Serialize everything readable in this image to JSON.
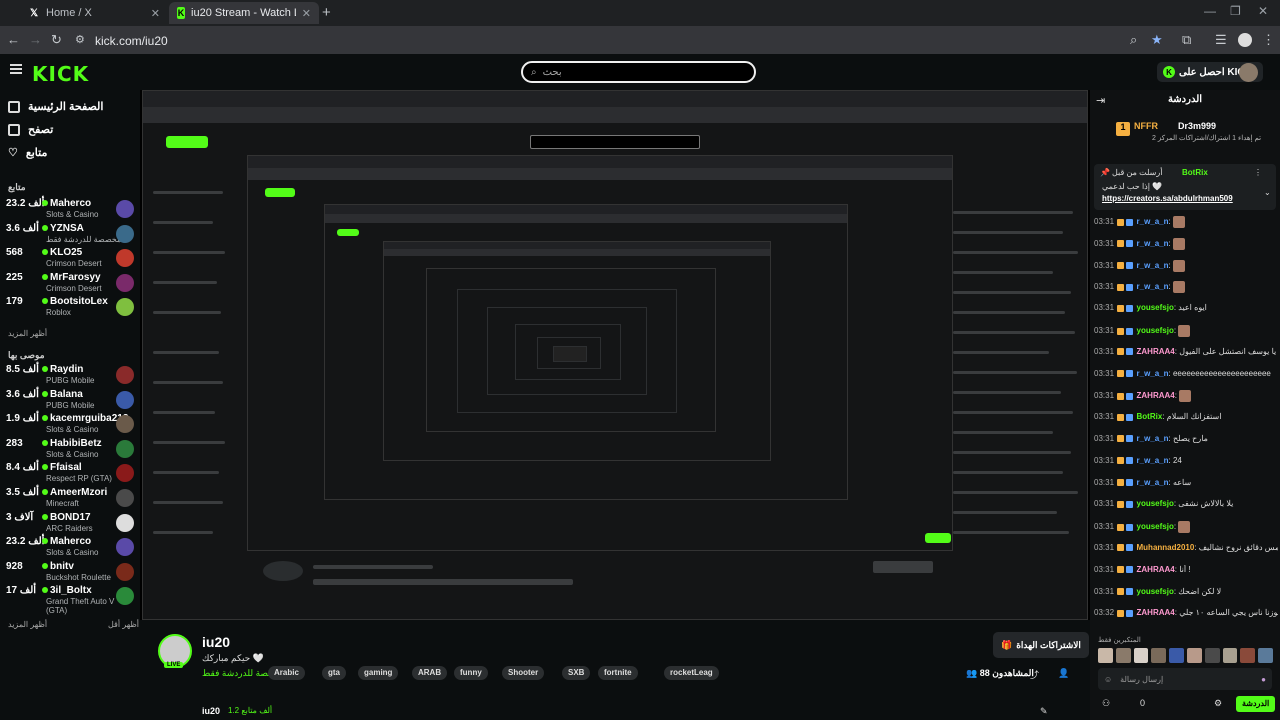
{
  "browser": {
    "tabs": [
      {
        "title": "Home / X",
        "icon": "x-logo-icon"
      },
      {
        "title": "iu20 Stream - Watch Live on Kic",
        "icon": "kick-logo-icon"
      }
    ],
    "new_tab": "+",
    "url": "kick.com/iu20"
  },
  "header": {
    "logo": "KICK",
    "search_placeholder": "بحث",
    "kicks_button": "احصل على KICKs"
  },
  "sidebar": {
    "nav": [
      {
        "label": "الصفحة الرئيسية",
        "icon": "home-icon"
      },
      {
        "label": "تصفح",
        "icon": "browse-icon"
      },
      {
        "label": "متابع",
        "icon": "heart-icon"
      }
    ],
    "following_title": "متابع",
    "following": [
      {
        "count": "23.2 ألف",
        "name": "Maherco",
        "category": "Slots & Casino",
        "color": "#5a4aa8"
      },
      {
        "count": "3.6 ألف",
        "name": "YZNSA",
        "category": "مخصصة للدردشة فقط",
        "color": "#3a6a8a"
      },
      {
        "count": "568",
        "name": "KLO25",
        "category": "Crimson Desert",
        "color": "#c0392b"
      },
      {
        "count": "225",
        "name": "MrFarosyy",
        "category": "Crimson Desert",
        "color": "#7a2a6a"
      },
      {
        "count": "179",
        "name": "BootsitoLex",
        "category": "Roblox",
        "color": "#7fbf3f"
      }
    ],
    "show_more_1": "أظهر المزيد",
    "recommended_title": "موصى بها",
    "recommended": [
      {
        "count": "8.5 ألف",
        "name": "Raydin",
        "category": "PUBG Mobile",
        "color": "#8a2a2a"
      },
      {
        "count": "3.6 ألف",
        "name": "Balana",
        "category": "PUBG Mobile",
        "color": "#3a5aa8"
      },
      {
        "count": "1.9 ألف",
        "name": "kacemrguiba213",
        "category": "Slots & Casino",
        "color": "#6a5a4a"
      },
      {
        "count": "283",
        "name": "HabibiBetz",
        "category": "Slots & Casino",
        "color": "#2a7a3a"
      },
      {
        "count": "8.4 ألف",
        "name": "Ffaisal",
        "category": "Respect RP (GTA)",
        "color": "#8a1a1a"
      },
      {
        "count": "3.5 ألف",
        "name": "AmeerMzori",
        "category": "Minecraft",
        "color": "#4a4a4a"
      },
      {
        "count": "3 آلاف",
        "name": "BOND17",
        "category": "ARC Raiders",
        "color": "#dddddd"
      },
      {
        "count": "23.2 ألف",
        "name": "Maherco",
        "category": "Slots & Casino",
        "color": "#5a4aa8"
      },
      {
        "count": "928",
        "name": "bnitv",
        "category": "Buckshot Roulette",
        "color": "#7a2a1a"
      },
      {
        "count": "17 ألف",
        "name": "3il_Boltx",
        "category": "Grand Theft Auto V (GTA)",
        "color": "#2a8a3a"
      }
    ],
    "show_more_2": "أظهر المزيد",
    "show_less": "أظهر أقل"
  },
  "stream": {
    "name": "iu20",
    "subtitle": "حيكم مباركك 🤍",
    "category": "مخصصة للدردشة فقط",
    "live": "LIVE",
    "tags": [
      "Arabic",
      "gta",
      "gaming",
      "ARAB",
      "funny",
      "Shooter",
      "SXB",
      "fortnite",
      "rocketLeag"
    ],
    "subs_button": "الاشتراكات الهداة",
    "viewers": "المشاهدون 88",
    "followers": "ألف متابع 1.2",
    "followers_name": "iu20"
  },
  "chat": {
    "title": "الدردشة",
    "top_user": "Dr3m999",
    "top_user_sub": "تم إهداء 1 اشتراك/اشتراكات المركز 2",
    "top_left": "NFFR",
    "pinned_by": "أرسلت من قبل",
    "pinned_user": "BotRix",
    "pinned_text": "إذا حب لدعمي 🤍",
    "pinned_link": "https://creators.sa/abdulrhman509",
    "messages": [
      {
        "time": "03:31",
        "user": "r_w_a_n",
        "text": "",
        "color": "#5aa0ff"
      },
      {
        "time": "03:31",
        "user": "r_w_a_n",
        "text": "",
        "color": "#5aa0ff"
      },
      {
        "time": "03:31",
        "user": "r_w_a_n",
        "text": "",
        "color": "#5aa0ff"
      },
      {
        "time": "03:31",
        "user": "r_w_a_n",
        "text": "",
        "color": "#5aa0ff"
      },
      {
        "time": "03:31",
        "user": "yousefsjo",
        "text": "ايوه اعيد",
        "color": "#53fc18"
      },
      {
        "time": "03:31",
        "user": "yousefsjo",
        "text": "",
        "color": "#53fc18"
      },
      {
        "time": "03:31",
        "user": "ZAHRAA4",
        "text": "يا يوسف انصتشل على الفيول",
        "color": "#ff9ad0"
      },
      {
        "time": "03:31",
        "user": "r_w_a_n",
        "text": "eeeeeeeeeeeeeeeeeeeeee",
        "color": "#5aa0ff"
      },
      {
        "time": "03:31",
        "user": "ZAHRAA4",
        "text": "",
        "color": "#ff9ad0"
      },
      {
        "time": "03:31",
        "user": "BotRix",
        "text": "استفزانك السلام",
        "color": "#53fc18"
      },
      {
        "time": "03:31",
        "user": "r_w_a_n",
        "text": "مارح يصلح",
        "color": "#5aa0ff"
      },
      {
        "time": "03:31",
        "user": "r_w_a_n",
        "text": "24",
        "color": "#5aa0ff"
      },
      {
        "time": "03:31",
        "user": "r_w_a_n",
        "text": "ساعه",
        "color": "#5aa0ff"
      },
      {
        "time": "03:31",
        "user": "yousefsjo",
        "text": "يلا بالالاش نشفى",
        "color": "#53fc18"
      },
      {
        "time": "03:31",
        "user": "yousefsjo",
        "text": "",
        "color": "#53fc18"
      },
      {
        "time": "03:31",
        "user": "Muhannad2010",
        "text": "ترييد نايم ابيت خمس دقائق نروح نشاليف",
        "color": "#f5b041"
      },
      {
        "time": "03:31",
        "user": "ZAHRAA4",
        "text": "أنا !",
        "color": "#ff9ad0"
      },
      {
        "time": "03:31",
        "user": "yousefsjo",
        "text": "لا لكن اضحك",
        "color": "#53fc18"
      },
      {
        "time": "03:32",
        "user": "ZAHRAA4",
        "text": "يجوزنا ناس يجي الساعه ١٠ جلي",
        "color": "#ff9ad0"
      }
    ],
    "chatters_title": "المتكبرين فقط",
    "input_placeholder": "إرسال رسالة",
    "send_button": "الدردشة",
    "counter": "0"
  },
  "colors": {
    "accent": "#53fc18",
    "background": "#0b0e0f"
  }
}
